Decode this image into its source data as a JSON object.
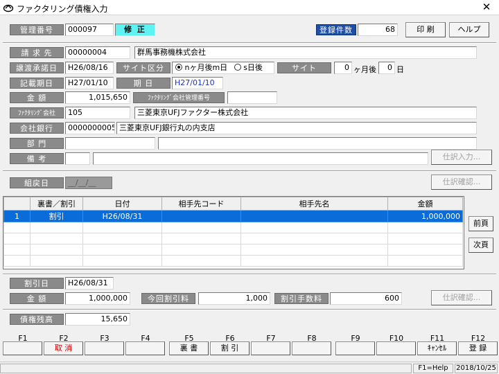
{
  "window": {
    "title": "ファクタリング債権入力",
    "close": "✕"
  },
  "header": {
    "mgmt_label": "管理番号",
    "mgmt_no": "000097",
    "mode": "修 正",
    "count_label": "登録件数",
    "count": "68",
    "print": "印 刷",
    "help": "ヘルプ"
  },
  "form": {
    "client_label": "請 求 先",
    "client_code": "00000004",
    "client_name": "群馬事務機株式会社",
    "transfer_date_label": "譲渡承諾日",
    "transfer_date": "H26/08/16",
    "site_type_label": "サイト区分",
    "site_opt1": "nヶ月後m日",
    "site_opt2": "s日後",
    "site_label": "サイト",
    "site_months": "0",
    "site_months_unit": "ヶ月後",
    "site_days": "0",
    "site_days_unit": "日",
    "record_date_label": "記載期日",
    "record_date": "H27/01/10",
    "due_label": "期 日",
    "due_date": "H27/01/10",
    "amount_label": "金 額",
    "amount": "1,015,650",
    "factor_mgmt_label": "ﾌｧｸﾀﾘﾝｸﾞ会社管理番号",
    "factor_mgmt": "",
    "factor_label": "ﾌｧｸﾀﾘﾝｸﾞ会社",
    "factor_code": "105",
    "factor_name": "三菱東京UFJファクター株式会社",
    "bank_label": "会社銀行",
    "bank_code": "0000000005",
    "bank_name": "三菱東京UFJ銀行丸の内支店",
    "dept_label": "部 門",
    "dept_code": "",
    "dept_name": "",
    "note_label": "備 考",
    "note_code": "",
    "note_text": "",
    "journal_input": "仕訳入力...",
    "return_date_label": "組戻日",
    "return_date": "__/__/__",
    "journal_confirm": "仕訳確認..."
  },
  "grid": {
    "columns": [
      "裏書／割引",
      "日付",
      "相手先コード",
      "相手先名",
      "金額"
    ],
    "rows": [
      {
        "no": "1",
        "type": "割引",
        "date": "H26/08/31",
        "code": "",
        "name": "",
        "amount": "1,000,000"
      }
    ],
    "next_page": "前頁",
    "prev_page": "次頁"
  },
  "discount": {
    "date_label": "割引日",
    "date": "H26/08/31",
    "amount_label": "金 額",
    "amount": "1,000,000",
    "fee_label": "今回割引料",
    "fee": "1,000",
    "charge_label": "割引手数料",
    "charge": "600",
    "journal_confirm": "仕訳確認..."
  },
  "balance": {
    "label": "債権残高",
    "value": "15,650"
  },
  "fkeys": [
    {
      "key": "F1",
      "label": ""
    },
    {
      "key": "F2",
      "label": "取 消"
    },
    {
      "key": "F3",
      "label": ""
    },
    {
      "key": "F4",
      "label": ""
    },
    {
      "key": "F5",
      "label": "裏 書"
    },
    {
      "key": "F6",
      "label": "割 引"
    },
    {
      "key": "F7",
      "label": ""
    },
    {
      "key": "F8",
      "label": ""
    },
    {
      "key": "F9",
      "label": ""
    },
    {
      "key": "F10",
      "label": ""
    },
    {
      "key": "F11",
      "label": "ｷｬﾝｾﾙ"
    },
    {
      "key": "F12",
      "label": "登 録"
    }
  ],
  "status": {
    "help": "F1=Help",
    "date": "2018/10/25"
  },
  "colors": {
    "label_gray": "#8a8a8a",
    "label_blue": "#1e4fa8",
    "mode_cyan": "#5ef2f2",
    "row_select": "#0a6cd8",
    "cancel_red": "#d00000"
  }
}
